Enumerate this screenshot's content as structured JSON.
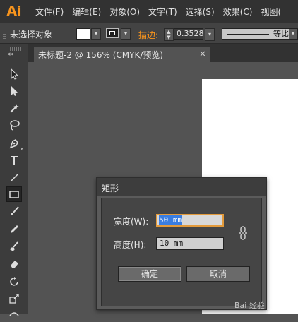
{
  "app": {
    "logo": "Ai"
  },
  "menu": [
    "文件(F)",
    "编辑(E)",
    "对象(O)",
    "文字(T)",
    "选择(S)",
    "效果(C)",
    "视图("
  ],
  "control_bar": {
    "selection": "未选择对象",
    "stroke_label": "描边:",
    "stroke_value": "0.3528",
    "profile": "等比"
  },
  "document_tab": {
    "title": "未标题-2 @ 156% (CMYK/预览)",
    "close": "×"
  },
  "tools": [
    "selection-tool-icon",
    "direct-selection-tool-icon",
    "magic-wand-icon",
    "lasso-icon",
    "pen-icon",
    "type-icon",
    "line-icon",
    "rectangle-icon",
    "paintbrush-icon",
    "pencil-icon",
    "blob-brush-icon",
    "eraser-icon",
    "rotate-icon",
    "scale-icon",
    "width-icon"
  ],
  "dialog": {
    "title": "矩形",
    "width_label": "宽度(W):",
    "width_value": "50 mm",
    "height_label": "高度(H):",
    "height_value": "10 mm",
    "ok": "确定",
    "cancel": "取消"
  },
  "watermark": "Bai 经验"
}
